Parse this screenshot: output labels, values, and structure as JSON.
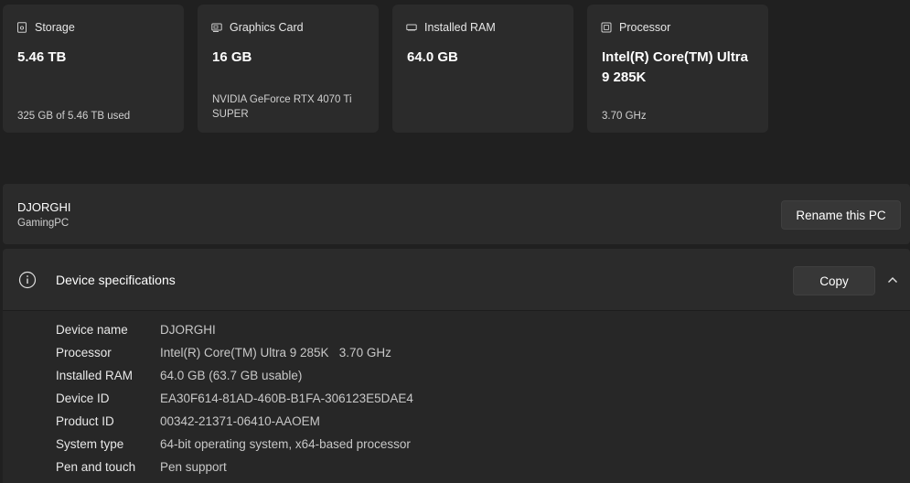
{
  "cards": [
    {
      "icon": "storage-icon",
      "title": "Storage",
      "value": "5.46 TB",
      "sub": "325 GB of 5.46 TB used"
    },
    {
      "icon": "graphics-card-icon",
      "title": "Graphics Card",
      "value": "16 GB",
      "sub": "NVIDIA GeForce RTX 4070 Ti SUPER"
    },
    {
      "icon": "ram-icon",
      "title": "Installed RAM",
      "value": "64.0 GB",
      "sub": ""
    },
    {
      "icon": "processor-icon",
      "title": "Processor",
      "value": "Intel(R) Core(TM) Ultra 9 285K",
      "sub": "3.70 GHz"
    }
  ],
  "pc": {
    "name": "DJORGHI",
    "model": "GamingPC",
    "rename_label": "Rename this PC"
  },
  "specs": {
    "title": "Device specifications",
    "copy_label": "Copy",
    "rows": [
      {
        "label": "Device name",
        "value": "DJORGHI"
      },
      {
        "label": "Processor",
        "value": "Intel(R) Core(TM) Ultra 9 285K   3.70 GHz"
      },
      {
        "label": "Installed RAM",
        "value": "64.0 GB (63.7 GB usable)"
      },
      {
        "label": "Device ID",
        "value": "EA30F614-81AD-460B-B1FA-306123E5DAE4"
      },
      {
        "label": "Product ID",
        "value": "00342-21371-06410-AAOEM"
      },
      {
        "label": "System type",
        "value": "64-bit operating system, x64-based processor"
      },
      {
        "label": "Pen and touch",
        "value": "Pen support"
      }
    ]
  },
  "colors": {
    "background": "#202020",
    "card": "#2b2b2b",
    "button": "#373737"
  }
}
